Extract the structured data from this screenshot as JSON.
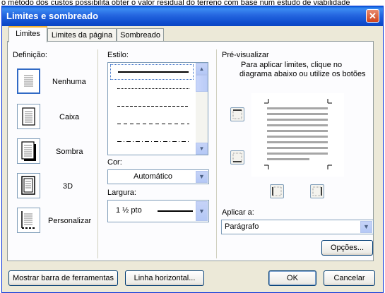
{
  "background_text": "o método dos custos possibilita obter o valor residual do terreno com base num estudo de viabilidade",
  "dialog": {
    "title": "Limites e sombreado",
    "close_symbol": "✕",
    "tabs": [
      {
        "label": "Limites",
        "active": true
      },
      {
        "label": "Limites da página",
        "active": false
      },
      {
        "label": "Sombreado",
        "active": false
      }
    ]
  },
  "settings": {
    "heading": "Definição:",
    "items": [
      {
        "label": "Nenhuma",
        "selected": true,
        "icon": "setting-none-icon"
      },
      {
        "label": "Caixa",
        "selected": false,
        "icon": "setting-box-icon"
      },
      {
        "label": "Sombra",
        "selected": false,
        "icon": "setting-shadow-icon"
      },
      {
        "label": "3D",
        "selected": false,
        "icon": "setting-3d-icon"
      },
      {
        "label": "Personalizar",
        "selected": false,
        "icon": "setting-custom-icon"
      }
    ]
  },
  "style": {
    "heading": "Estilo:",
    "items": [
      "solid",
      "dotted",
      "dashed-small",
      "dashed",
      "dash-dot"
    ],
    "selected_index": 0
  },
  "color": {
    "label": "Cor:",
    "value": "Automático"
  },
  "width": {
    "label": "Largura:",
    "value": "1 ½ pto"
  },
  "preview": {
    "heading": "Pré-visualizar",
    "instructions_line1": "Para aplicar limites, clique no",
    "instructions_line2": "diagrama abaixo ou utilize os botões"
  },
  "apply": {
    "label": "Aplicar a:",
    "value": "Parágrafo"
  },
  "buttons": {
    "options": "Opções...",
    "show_toolbar": "Mostrar barra de ferramentas",
    "horizontal_line": "Linha horizontal...",
    "ok": "OK",
    "cancel": "Cancelar"
  },
  "colors": {
    "title_bar": "#0a5fd8",
    "dialog_bg": "#ece9d8",
    "selection": "#316ac5",
    "close_button": "#d0441c"
  }
}
